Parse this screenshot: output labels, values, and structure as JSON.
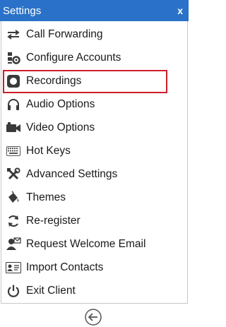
{
  "window": {
    "title": "Settings",
    "close_label": "x"
  },
  "menu": {
    "items": [
      {
        "label": "Call Forwarding",
        "icon": "call-forwarding-icon"
      },
      {
        "label": "Configure Accounts",
        "icon": "configure-accounts-icon"
      },
      {
        "label": "Recordings",
        "icon": "recordings-icon",
        "selected": true
      },
      {
        "label": "Audio Options",
        "icon": "headphones-icon"
      },
      {
        "label": "Video Options",
        "icon": "video-camera-icon"
      },
      {
        "label": "Hot Keys",
        "icon": "keyboard-icon"
      },
      {
        "label": "Advanced Settings",
        "icon": "tools-icon"
      },
      {
        "label": "Themes",
        "icon": "paint-bucket-icon"
      },
      {
        "label": "Re-register",
        "icon": "refresh-icon"
      },
      {
        "label": "Request Welcome Email",
        "icon": "user-mail-icon"
      },
      {
        "label": "Import Contacts",
        "icon": "contact-card-icon"
      },
      {
        "label": "Exit Client",
        "icon": "power-icon"
      }
    ]
  },
  "footer": {
    "back_icon": "back-arrow-icon"
  },
  "colors": {
    "titlebar": "#2a72c9",
    "selection_border": "#cc1f2d",
    "icon": "#3a3a3a"
  }
}
